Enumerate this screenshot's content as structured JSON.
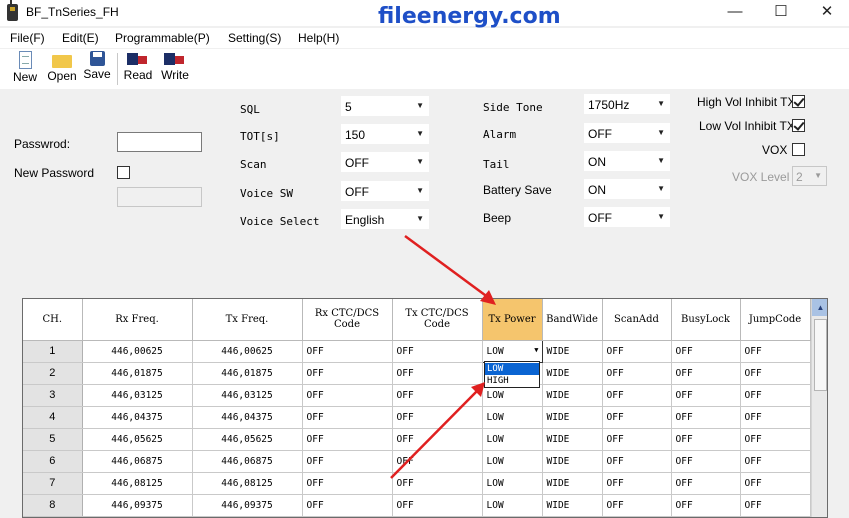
{
  "window": {
    "title": "BF_TnSeries_FH",
    "watermark": "fileenergy.com",
    "minimize_glyph": "—",
    "maximize_glyph": "☐",
    "close_glyph": "✕"
  },
  "menu": [
    {
      "label": "File(F)"
    },
    {
      "label": "Edit(E)"
    },
    {
      "label": "Programmable(P)"
    },
    {
      "label": "Setting(S)"
    },
    {
      "label": "Help(H)"
    }
  ],
  "toolbar": {
    "new_label": "New",
    "open_label": "Open",
    "save_label": "Save",
    "read_label": "Read",
    "write_label": "Write"
  },
  "password": {
    "password_label": "Passwrod:",
    "new_password_label": "New Password",
    "password_value": "",
    "new_password_value": "",
    "new_password_checked": false
  },
  "settings_col1": [
    {
      "label": "SQL",
      "value": "5"
    },
    {
      "label": "TOT[s]",
      "value": "150"
    },
    {
      "label": "Scan",
      "value": "OFF"
    },
    {
      "label": "Voice SW",
      "value": "OFF"
    },
    {
      "label": "Voice Select",
      "value": "English"
    }
  ],
  "settings_col2": [
    {
      "label": "Side Tone",
      "value": "1750Hz"
    },
    {
      "label": "Alarm",
      "value": "OFF"
    },
    {
      "label": "Tail",
      "value": "ON"
    },
    {
      "label": "Battery Save",
      "value": "ON"
    },
    {
      "label": "Beep",
      "value": "OFF"
    }
  ],
  "settings_col3": {
    "high_vol_label": "High Vol Inhibit TX",
    "high_vol_checked": true,
    "low_vol_label": "Low Vol Inhibit TX",
    "low_vol_checked": true,
    "vox_label": "VOX",
    "vox_checked": false,
    "vox_level_label": "VOX Level",
    "vox_level_value": "2"
  },
  "grid": {
    "headers": [
      "CH.",
      "Rx Freq.",
      "Tx Freq.",
      "Rx CTC/DCS Code",
      "Tx CTC/DCS Code",
      "Tx Power",
      "BandWide",
      "ScanAdd",
      "BusyLock",
      "JumpCode"
    ],
    "highlighted_header": "Tx Power",
    "rows": [
      [
        "1",
        "446,00625",
        "446,00625",
        "OFF",
        "OFF",
        "LOW",
        "WIDE",
        "OFF",
        "OFF",
        "OFF"
      ],
      [
        "2",
        "446,01875",
        "446,01875",
        "OFF",
        "OFF",
        "",
        "WIDE",
        "OFF",
        "OFF",
        "OFF"
      ],
      [
        "3",
        "446,03125",
        "446,03125",
        "OFF",
        "OFF",
        "LOW",
        "WIDE",
        "OFF",
        "OFF",
        "OFF"
      ],
      [
        "4",
        "446,04375",
        "446,04375",
        "OFF",
        "OFF",
        "LOW",
        "WIDE",
        "OFF",
        "OFF",
        "OFF"
      ],
      [
        "5",
        "446,05625",
        "446,05625",
        "OFF",
        "OFF",
        "LOW",
        "WIDE",
        "OFF",
        "OFF",
        "OFF"
      ],
      [
        "6",
        "446,06875",
        "446,06875",
        "OFF",
        "OFF",
        "LOW",
        "WIDE",
        "OFF",
        "OFF",
        "OFF"
      ],
      [
        "7",
        "446,08125",
        "446,08125",
        "OFF",
        "OFF",
        "LOW",
        "WIDE",
        "OFF",
        "OFF",
        "OFF"
      ],
      [
        "8",
        "446,09375",
        "446,09375",
        "OFF",
        "OFF",
        "LOW",
        "WIDE",
        "OFF",
        "OFF",
        "OFF"
      ]
    ],
    "dropdown_options": [
      "LOW",
      "HIGH"
    ],
    "dropdown_selected": "LOW"
  },
  "colors": {
    "watermark": "#1e4fc7",
    "header_highlight": "#f5c56d",
    "selection": "#0a64d2",
    "annotation_arrow": "#e02020"
  },
  "icons": [
    "app-icon",
    "new-icon",
    "open-folder-icon",
    "save-icon",
    "read-icon",
    "write-icon",
    "minimize-icon",
    "maximize-icon",
    "close-icon",
    "chevron-down-icon"
  ]
}
